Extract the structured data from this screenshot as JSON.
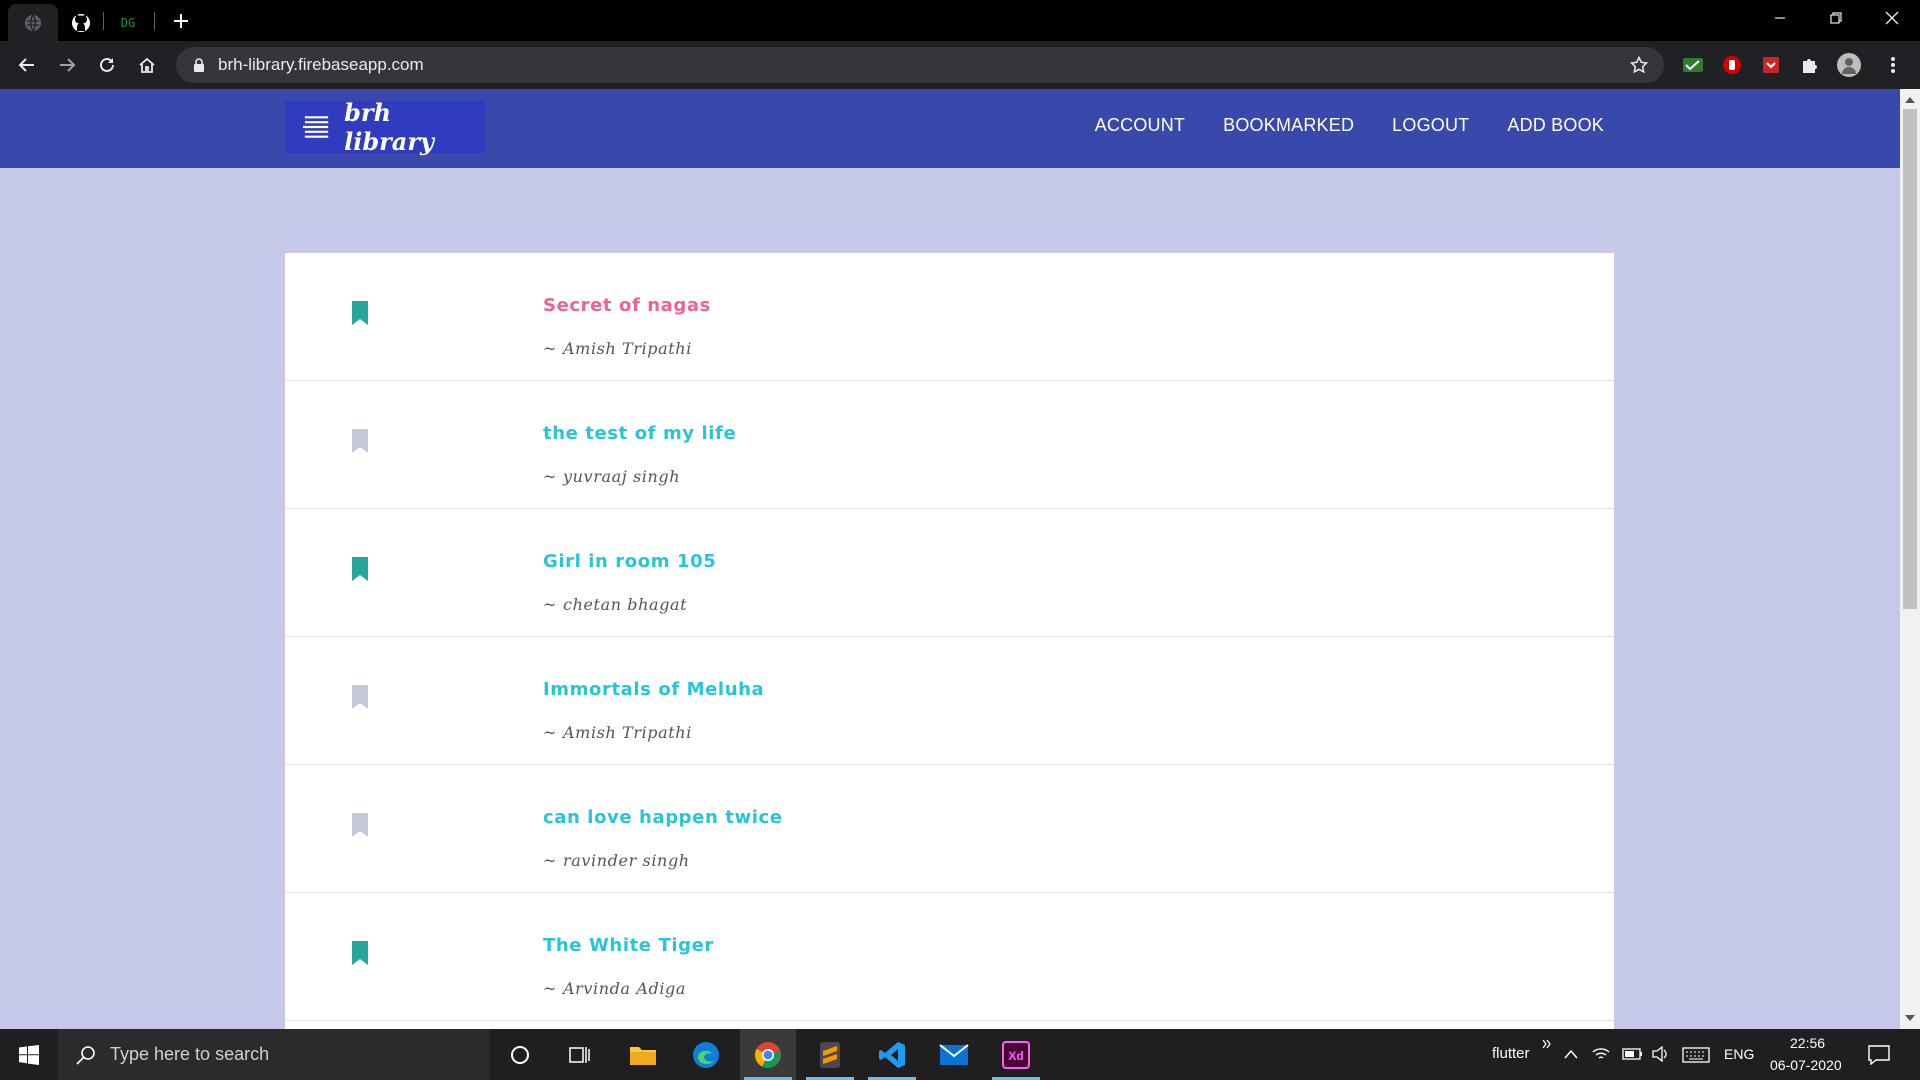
{
  "browser": {
    "url": "brh-library.firebaseapp.com",
    "dg_tab_label": "DG"
  },
  "app": {
    "brand": "brh library",
    "nav": [
      "ACCOUNT",
      "BOOKMARKED",
      "LOGOUT",
      "ADD BOOK"
    ]
  },
  "books": [
    {
      "title": "Secret of nagas",
      "author": "Amish Tripathi",
      "bookmarked": true,
      "title_color": "#f06292"
    },
    {
      "title": "the test of my life",
      "author": "yuvraaj singh",
      "bookmarked": false,
      "title_color": "#26c6da"
    },
    {
      "title": "Girl in room 105",
      "author": "chetan bhagat",
      "bookmarked": true,
      "title_color": "#26c6da"
    },
    {
      "title": "Immortals of Meluha",
      "author": "Amish Tripathi",
      "bookmarked": false,
      "title_color": "#26c6da"
    },
    {
      "title": "can love happen twice",
      "author": "ravinder singh",
      "bookmarked": false,
      "title_color": "#26c6da"
    },
    {
      "title": "The White Tiger",
      "author": "Arvinda Adiga",
      "bookmarked": true,
      "title_color": "#26c6da"
    }
  ],
  "colors": {
    "appbar": "#3949ab",
    "page_bg": "#c5c8e8",
    "bookmark_on": "#26a69a",
    "bookmark_off": "#c5c8d8"
  },
  "taskbar": {
    "search_placeholder": "Type here to search",
    "tray_app": "flutter",
    "language": "ENG",
    "time": "22:56",
    "date": "06-07-2020"
  }
}
